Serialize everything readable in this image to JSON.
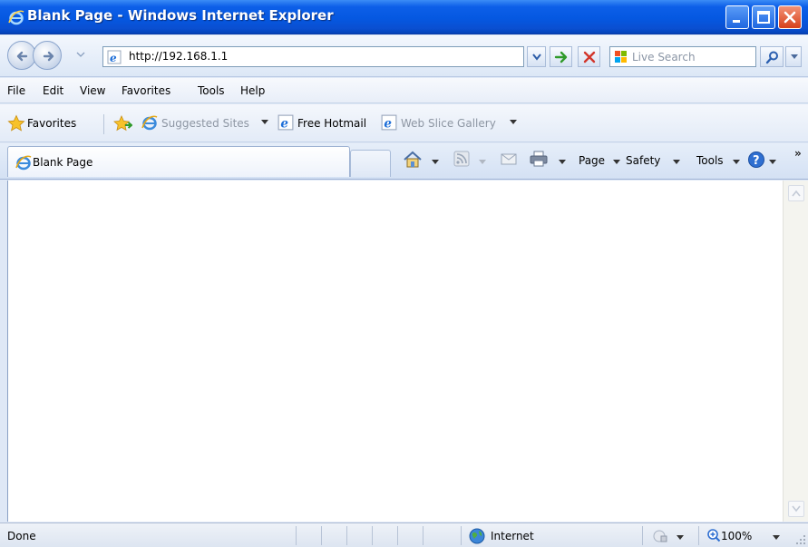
{
  "window": {
    "title": "Blank Page - Windows Internet Explorer",
    "buttons": [
      "minimize",
      "maximize",
      "close"
    ]
  },
  "address_bar": {
    "url": "http://192.168.1.1"
  },
  "search": {
    "placeholder": "Live Search",
    "provider_icon": "live-search-icon"
  },
  "menu": {
    "items": [
      "File",
      "Edit",
      "View",
      "Favorites",
      "Tools",
      "Help"
    ]
  },
  "favorites_bar": {
    "favorites_label": "Favorites",
    "items": [
      {
        "label": "Suggested Sites",
        "dimmed": true
      },
      {
        "label": "Free Hotmail",
        "dimmed": false
      },
      {
        "label": "Web Slice Gallery",
        "dimmed": true
      }
    ]
  },
  "tabs": {
    "active_title": "Blank Page"
  },
  "command_bar": {
    "page_label": "Page",
    "safety_label": "Safety",
    "tools_label": "Tools",
    "more": "»"
  },
  "status_bar": {
    "status_text": "Done",
    "zone": "Internet",
    "zoom": "100%"
  },
  "colors": {
    "titlebar_blue": "#0558e1",
    "close_red": "#d7411b",
    "chrome_bg": "#dfe8f6",
    "dimmed_text": "#8d96a3"
  }
}
